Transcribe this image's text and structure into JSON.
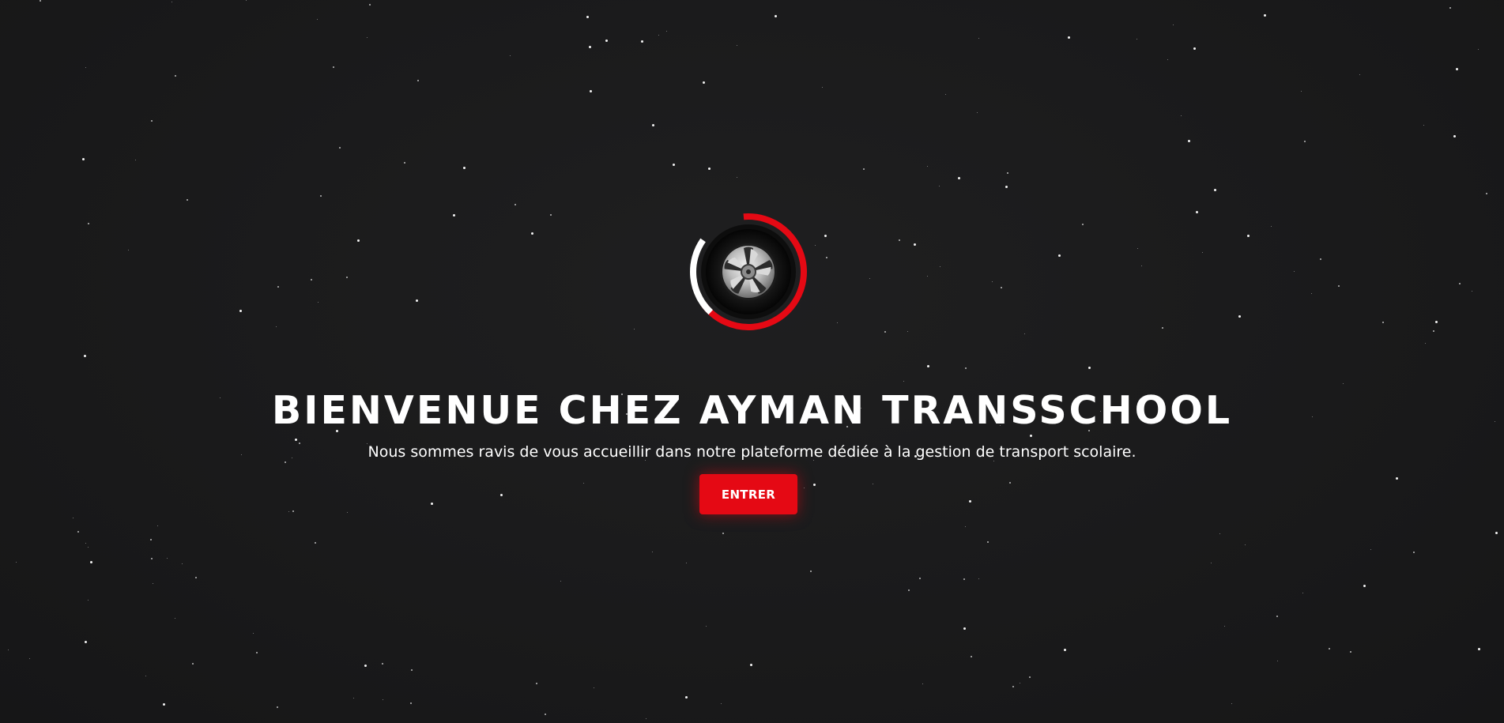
{
  "welcome": {
    "title": "BIENVENUE CHEZ AYMAN TRANSSCHOOL",
    "subtitle": "Nous sommes ravis de vous accueillir dans notre plateforme dédiée à la gestion de transport scolaire.",
    "enter_label": "ENTRER"
  },
  "logo": {
    "icon": "wheel-icon",
    "ring_accent": "#e50914",
    "ring_secondary": "#ffffff"
  },
  "colors": {
    "background": "#1a1a1b",
    "accent": "#e50914",
    "text": "#ffffff"
  }
}
